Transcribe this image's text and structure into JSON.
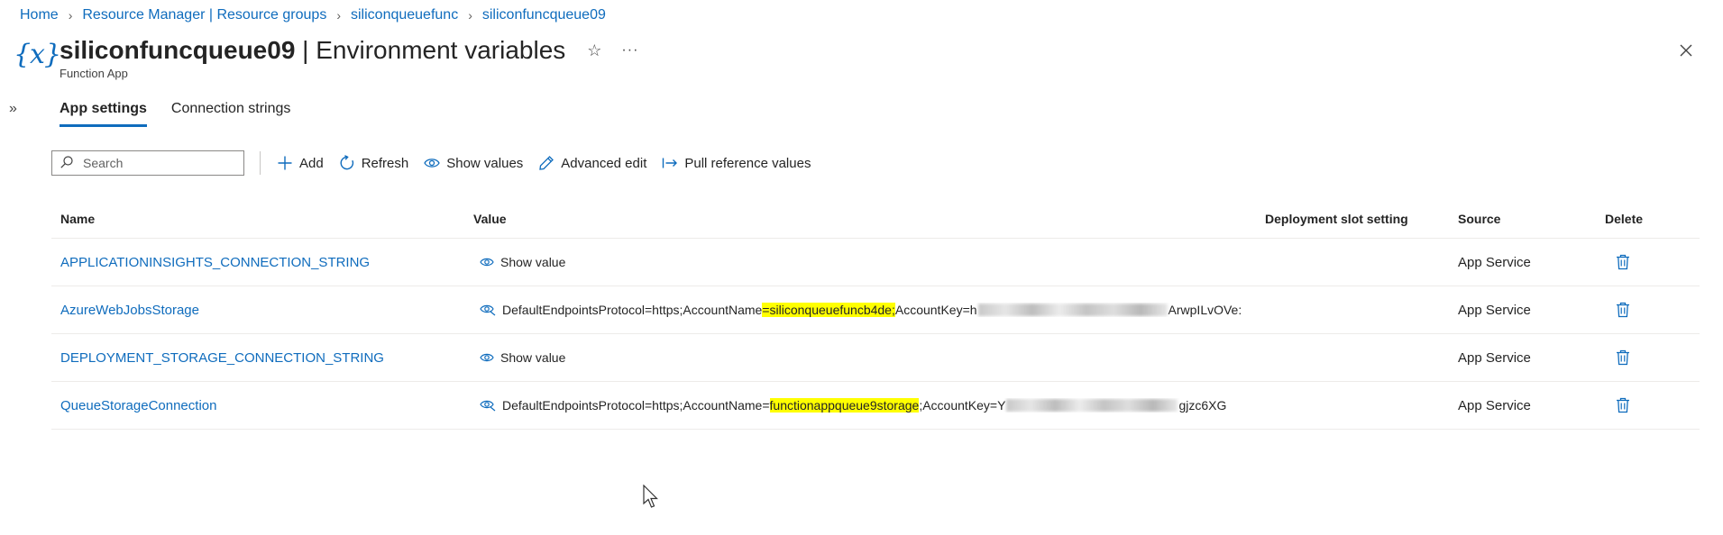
{
  "breadcrumb": [
    {
      "label": "Home"
    },
    {
      "label": "Resource Manager | Resource groups"
    },
    {
      "label": "siliconqueuefunc"
    },
    {
      "label": "siliconfuncqueue09"
    }
  ],
  "header": {
    "icon_glyph": "{x}",
    "resource_name": "siliconfuncqueue09",
    "separator": " | ",
    "page_name": "Environment variables",
    "subtitle": "Function App",
    "star_icon": "star-icon",
    "more_label": "···"
  },
  "tabs": [
    {
      "label": "App settings",
      "active": true
    },
    {
      "label": "Connection strings",
      "active": false
    }
  ],
  "toolbar": {
    "search_placeholder": "Search",
    "add_label": "Add",
    "refresh_label": "Refresh",
    "show_values_label": "Show values",
    "advanced_edit_label": "Advanced edit",
    "pull_reference_label": "Pull reference values"
  },
  "grid": {
    "columns": {
      "name": "Name",
      "value": "Value",
      "slot": "Deployment slot setting",
      "source": "Source",
      "delete": "Delete"
    },
    "rows": [
      {
        "name": "APPLICATIONINSIGHTS_CONNECTION_STRING",
        "value_hidden": true,
        "show_value_label": "Show value",
        "source": "App Service"
      },
      {
        "name": "AzureWebJobsStorage",
        "value_hidden": false,
        "value_prefix": "DefaultEndpointsProtocol=https;AccountName",
        "value_highlight": "=siliconqueuefuncb4de;",
        "value_key_label": "AccountKey=h",
        "value_suffix": "ArwpILvOVe:",
        "source": "App Service"
      },
      {
        "name": "DEPLOYMENT_STORAGE_CONNECTION_STRING",
        "value_hidden": true,
        "show_value_label": "Show value",
        "source": "App Service"
      },
      {
        "name": "QueueStorageConnection",
        "value_hidden": false,
        "value_prefix": "DefaultEndpointsProtocol=https;AccountName=",
        "value_highlight": "functionappqueue9storage",
        "value_key_label": ";AccountKey=Y",
        "value_suffix": "gjzc6XG",
        "source": "App Service"
      }
    ]
  },
  "colors": {
    "accent": "#0f6cbd",
    "highlight": "#ffff00",
    "text": "#242424"
  }
}
